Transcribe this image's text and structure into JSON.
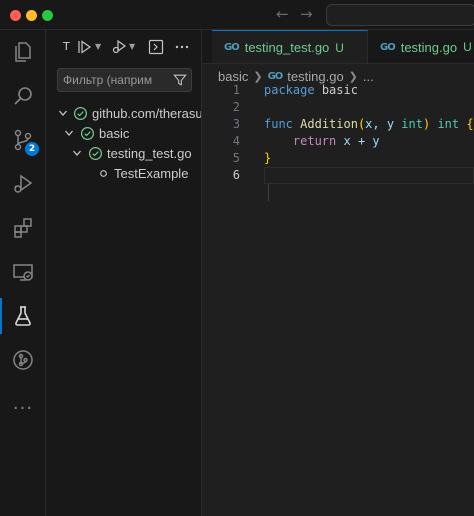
{
  "titlebar": {
    "back_icon": "arrow-left-icon",
    "forward_icon": "arrow-right-icon"
  },
  "activity_bar": {
    "items": [
      {
        "name": "explorer-icon"
      },
      {
        "name": "search-icon"
      },
      {
        "name": "source-control-icon",
        "badge": "2"
      },
      {
        "name": "run-debug-icon"
      },
      {
        "name": "extensions-icon"
      },
      {
        "name": "remote-explorer-icon"
      },
      {
        "name": "testing-icon",
        "active": true
      },
      {
        "name": "git-graph-icon"
      },
      {
        "name": "more-icon",
        "label": "···"
      }
    ]
  },
  "sidebar": {
    "title_short": "T",
    "filter": {
      "placeholder": "Фильтр (наприм"
    },
    "tree": [
      {
        "label": "github.com/therasul",
        "level": 0,
        "status": "passed"
      },
      {
        "label": "basic",
        "level": 1,
        "status": "passed"
      },
      {
        "label": "testing_test.go",
        "level": 2,
        "status": "passed"
      },
      {
        "label": "TestExample",
        "level": 3,
        "status": "unset"
      }
    ]
  },
  "editor": {
    "tabs": [
      {
        "icon": "GO",
        "name": "testing_test.go",
        "status": "U",
        "active": true
      },
      {
        "icon": "GO",
        "name": "testing.go",
        "status": "U",
        "active": false
      }
    ],
    "breadcrumb": {
      "folder": "basic",
      "icon": "GO",
      "file": "testing.go",
      "more": "..."
    },
    "line_numbers": [
      "1",
      "2",
      "3",
      "4",
      "5",
      "6"
    ],
    "code": {
      "line1_kw": "package",
      "line1_name": "basic",
      "line3_kw": "func",
      "line3_fn": "Addition",
      "line3_open": "(",
      "line3_params_a": "x, y ",
      "line3_type1": "int",
      "line3_close": ")",
      "line3_type2": "int",
      "line3_brace": "{",
      "line4_kw": "return",
      "line4_expr": "x + y",
      "line5_brace": "}"
    }
  },
  "colors": {
    "accent": "#0078d4",
    "untracked": "#73c991",
    "passed": "#73c991"
  }
}
